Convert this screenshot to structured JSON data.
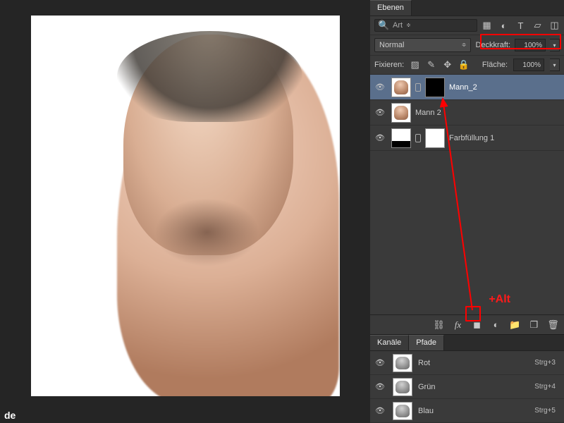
{
  "panel": {
    "layers_tab": "Ebenen",
    "channels_tab": "Kanäle",
    "paths_tab": "Pfade",
    "search_label": "Art",
    "blend_mode": "Normal",
    "opacity_label": "Deckkraft:",
    "opacity_value": "100%",
    "lock_label": "Fixieren:",
    "fill_label": "Fläche:",
    "fill_value": "100%"
  },
  "layers": [
    {
      "name": "Mann_2",
      "has_mask": true,
      "mask_black": true,
      "selected": true
    },
    {
      "name": "Mann 2",
      "has_mask": false
    },
    {
      "name": "Farbfüllung 1",
      "has_mask": true,
      "mask_black": false,
      "fill_layer": true
    }
  ],
  "channels": [
    {
      "name": "Rot",
      "shortcut": "Strg+3"
    },
    {
      "name": "Grün",
      "shortcut": "Strg+4"
    },
    {
      "name": "Blau",
      "shortcut": "Strg+5"
    }
  ],
  "annotation": {
    "alt_text": "+Alt"
  },
  "bottom_bar_icons": [
    "link-icon",
    "fx-icon",
    "add-mask-icon",
    "adjustment-icon",
    "group-icon",
    "new-layer-icon",
    "trash-icon"
  ],
  "footer": "de"
}
